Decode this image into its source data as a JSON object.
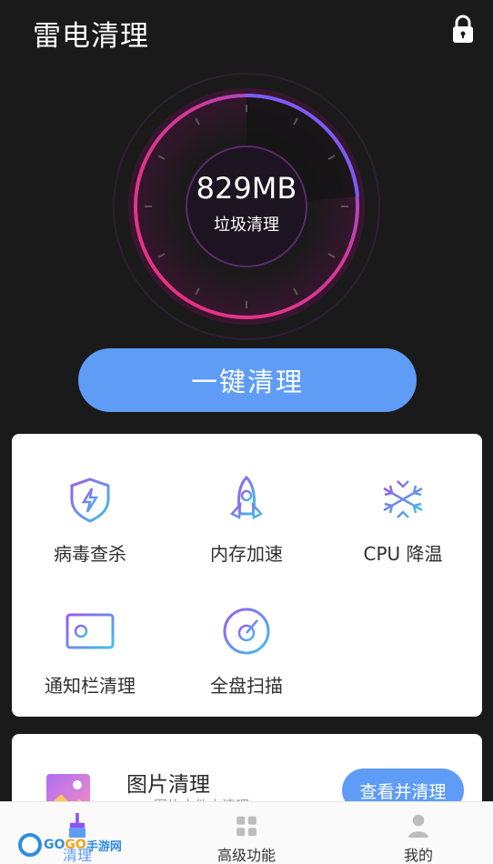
{
  "header": {
    "title": "雷电清理",
    "lock_icon": "lock-icon"
  },
  "gauge": {
    "value": "829MB",
    "label": "垃圾清理",
    "colors": {
      "start": "#e0367f",
      "end": "#8a52f5"
    }
  },
  "one_click_button": "一键清理",
  "tools": [
    {
      "label": "病毒查杀",
      "icon": "shield-lightning-icon"
    },
    {
      "label": "内存加速",
      "icon": "rocket-icon"
    },
    {
      "label": "CPU 降温",
      "icon": "snowflake-icon"
    },
    {
      "label": "通知栏清理",
      "icon": "notification-card-icon"
    },
    {
      "label": "全盘扫描",
      "icon": "disk-icon"
    }
  ],
  "picture_card": {
    "title": "图片清理",
    "subtitle": "……图片文件占清理",
    "action": "查看并清理",
    "icon": "image-icon"
  },
  "tabbar": {
    "tabs": [
      {
        "label": "清理",
        "icon": "broom-icon",
        "active": true
      },
      {
        "label": "高级功能",
        "icon": "grid-icon",
        "active": false
      },
      {
        "label": "我的",
        "icon": "user-icon",
        "active": false
      }
    ]
  },
  "watermark": {
    "part1": "GO",
    "part2": "GO",
    "part3": "手游网"
  },
  "colors": {
    "accent": "#5e9cf6",
    "background": "#1a1a1a"
  }
}
